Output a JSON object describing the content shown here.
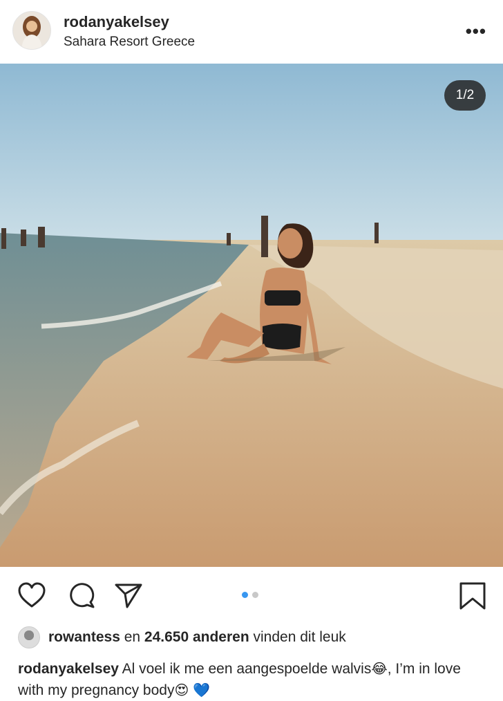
{
  "post": {
    "username": "rodanyakelsey",
    "location": "Sahara Resort Greece",
    "more_label": "•••",
    "carousel_counter": "1/2",
    "carousel": {
      "current": 1,
      "total": 2
    }
  },
  "actions": {
    "icons": [
      "heart-icon",
      "comment-icon",
      "share-icon",
      "bookmark-icon"
    ]
  },
  "likes": {
    "liker": "rowantess",
    "connector": " en ",
    "others_count": "24.650 anderen",
    "suffix": " vinden dit leuk"
  },
  "caption": {
    "author": "rodanyakelsey",
    "text_part1": " Al voel ik me een aangespoelde walvis",
    "emoji1": "😂",
    "text_part2": ", I’m in love with my pregnancy body",
    "emoji2": "😍",
    "emoji3": "💙"
  },
  "colors": {
    "accent": "#3897f0",
    "text": "#262626",
    "counter_bg": "#262626"
  }
}
